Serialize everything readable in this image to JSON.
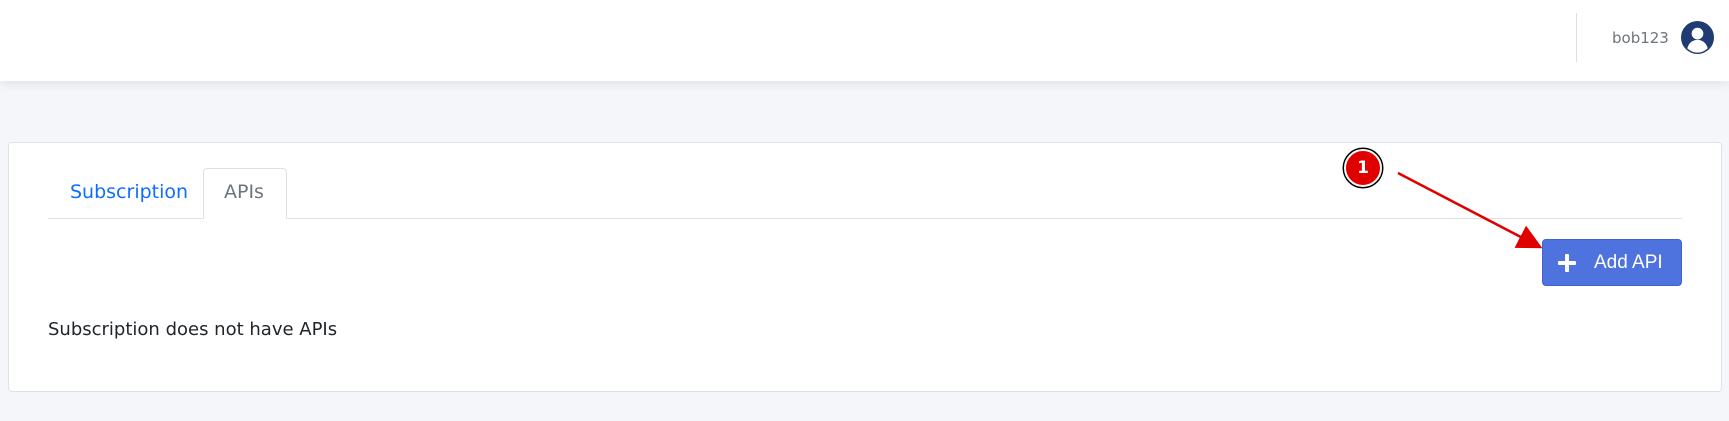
{
  "header": {
    "username": "bob123",
    "avatar_icon": "user-circle-icon"
  },
  "tabs": [
    {
      "label": "Subscription",
      "active": false
    },
    {
      "label": "APIs",
      "active": true
    }
  ],
  "actions": {
    "add_api_label": "Add API",
    "add_api_icon": "plus-icon"
  },
  "content": {
    "empty_message": "Subscription does not have APIs"
  },
  "annotation": {
    "step_number": "1",
    "color": "#e00000"
  },
  "colors": {
    "primary_button": "#4e73df",
    "tab_link": "#0d6efd",
    "page_background": "#f5f6fa"
  }
}
